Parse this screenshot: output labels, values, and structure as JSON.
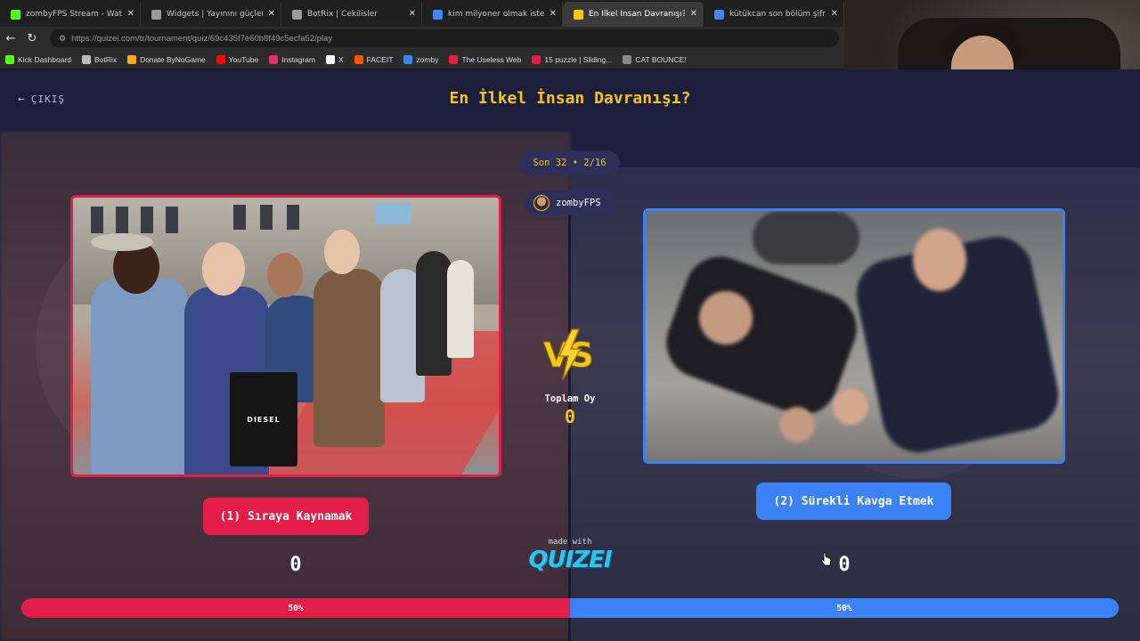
{
  "browser": {
    "tabs": [
      {
        "title": "zombyFPS Stream - Watch Live on",
        "icon": "kick-icon",
        "color": "#53fc18",
        "active": false
      },
      {
        "title": "Widgets | Yayınını güçlendirmek i",
        "icon": "botrix-icon",
        "color": "#9b9b9b",
        "active": false
      },
      {
        "title": "BotRix | Cekilisler",
        "icon": "botrix-icon",
        "color": "#9b9b9b",
        "active": false
      },
      {
        "title": "kim milyoner olmak ister oyna - G",
        "icon": "google-icon",
        "color": "#4285f4",
        "active": false
      },
      {
        "title": "En İlkel İnsan Davranışı? - Tier List",
        "icon": "quizei-icon",
        "color": "#f5c518",
        "active": true
      },
      {
        "title": "kütükcan son bölüm şifresi - Goog",
        "icon": "google-icon",
        "color": "#4285f4",
        "active": false
      }
    ],
    "url": "https://quizei.com/tr/tournament/quiz/69c435f7e60b8f49c5ecfa52/play",
    "bookmarks": [
      {
        "label": "Kick Dashboard",
        "color": "#53fc18"
      },
      {
        "label": "BotRix",
        "color": "#bbbbbb"
      },
      {
        "label": "Donate ByNoGame",
        "color": "#f5a623"
      },
      {
        "label": "YouTube",
        "color": "#ff0000"
      },
      {
        "label": "Instagram",
        "color": "#e1306c"
      },
      {
        "label": "X",
        "color": "#ffffff"
      },
      {
        "label": "FACEIT",
        "color": "#ff5500"
      },
      {
        "label": "zomby",
        "color": "#3b82f6"
      },
      {
        "label": "The Useless Web",
        "color": "#e11d48"
      },
      {
        "label": "15 puzzle | Sliding...",
        "color": "#e11d48"
      },
      {
        "label": "CAT BOUNCE!",
        "color": "#888888"
      }
    ]
  },
  "quiz": {
    "back_label": "ÇIKIŞ",
    "title": "En İlkel İnsan Davranışı?",
    "round": "Son 32 • 2/16",
    "user": "zombyFPS",
    "vs_label": "VS",
    "total_votes_label": "Toplam Oy",
    "total_votes": "0",
    "option1": {
      "label": "(1) Sıraya Kaynamak",
      "votes": "0",
      "percent": "50%",
      "share": 0.5,
      "color": "#e11d48",
      "bag_text": "DIESEL"
    },
    "option2": {
      "label": "(2) Sürekli Kavga Etmek",
      "votes": "0",
      "percent": "50%",
      "share": 0.5,
      "color": "#3b82f6"
    },
    "made_with": "made with",
    "brand": "QUIZEI"
  }
}
